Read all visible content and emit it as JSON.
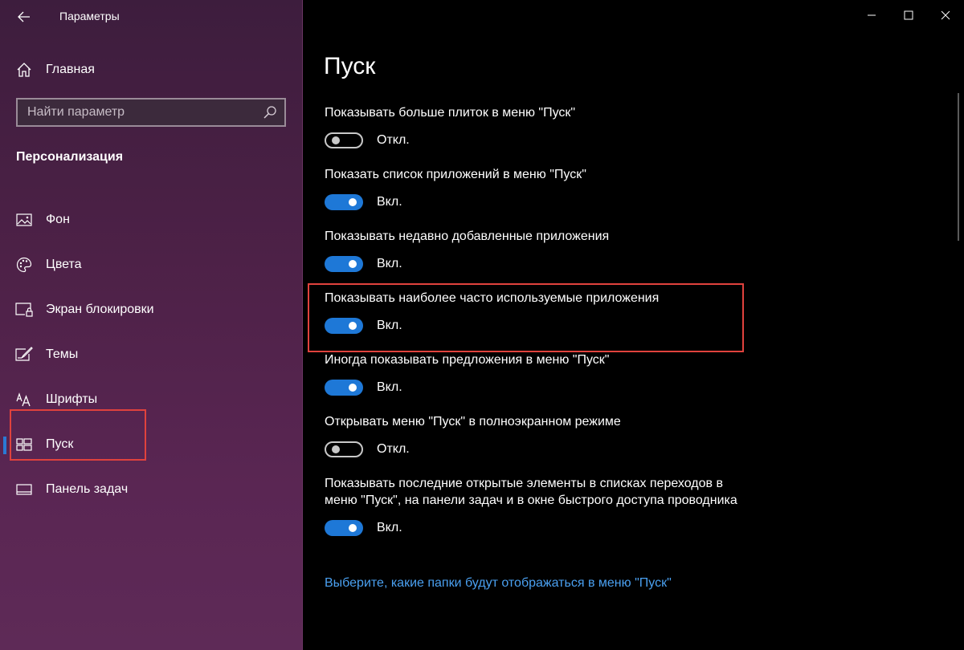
{
  "window": {
    "title": "Параметры"
  },
  "sidebar": {
    "home_label": "Главная",
    "search_placeholder": "Найти параметр",
    "section_title": "Персонализация",
    "items": [
      {
        "label": "Фон",
        "icon": "image-icon"
      },
      {
        "label": "Цвета",
        "icon": "palette-icon"
      },
      {
        "label": "Экран блокировки",
        "icon": "lock-screen-icon"
      },
      {
        "label": "Темы",
        "icon": "themes-icon"
      },
      {
        "label": "Шрифты",
        "icon": "fonts-icon"
      },
      {
        "label": "Пуск",
        "icon": "start-icon",
        "active": true
      },
      {
        "label": "Панель задач",
        "icon": "taskbar-icon"
      }
    ]
  },
  "main": {
    "title": "Пуск",
    "settings": [
      {
        "label": "Показывать больше плиток в меню \"Пуск\"",
        "state": "Откл.",
        "on": false
      },
      {
        "label": "Показать список приложений в меню \"Пуск\"",
        "state": "Вкл.",
        "on": true
      },
      {
        "label": "Показывать недавно добавленные приложения",
        "state": "Вкл.",
        "on": true
      },
      {
        "label": "Показывать наиболее часто используемые приложения",
        "state": "Вкл.",
        "on": true
      },
      {
        "label": "Иногда показывать предложения в меню \"Пуск\"",
        "state": "Вкл.",
        "on": true
      },
      {
        "label": "Открывать меню \"Пуск\" в полноэкранном режиме",
        "state": "Откл.",
        "on": false
      },
      {
        "label": "Показывать последние открытые элементы в списках переходов в меню \"Пуск\", на панели задач и в окне быстрого доступа проводника",
        "state": "Вкл.",
        "on": true
      }
    ],
    "link": "Выберите, какие папки будут отображаться в меню \"Пуск\""
  },
  "colors": {
    "accent": "#1e78d7",
    "link": "#4aa0f0",
    "highlight": "#e0423d"
  }
}
